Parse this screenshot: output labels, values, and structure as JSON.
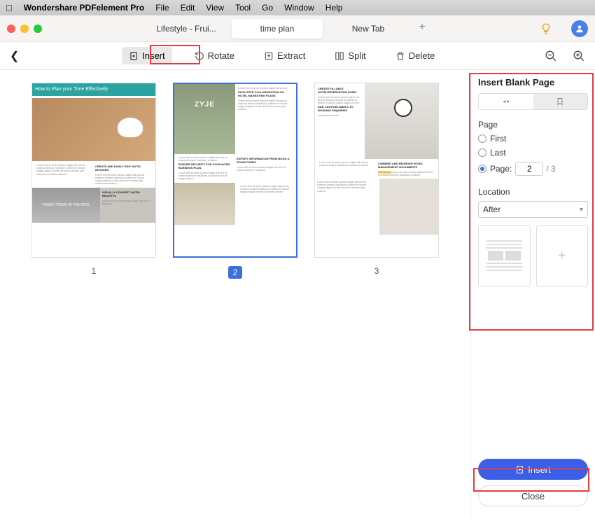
{
  "menubar": {
    "app": "Wondershare PDFelement Pro",
    "items": [
      "File",
      "Edit",
      "View",
      "Tool",
      "Go",
      "Window",
      "Help"
    ]
  },
  "tabs": {
    "t1": "Lifestyle - Frui...",
    "t2": "time plan",
    "t3": "New Tab"
  },
  "toolbar": {
    "insert": "Insert",
    "rotate": "Rotate",
    "extract": "Extract",
    "split": "Split",
    "delete": "Delete"
  },
  "pages": {
    "p1": "1",
    "p2": "2",
    "p3": "3",
    "title1": "How to Plan your Time Effectively",
    "sec1a": "CREATE AND EASILY EDIT HOTEL INVOICES",
    "sec1b": "VISUALLY CONVERT HOTEL RECEIPTS",
    "punch": "PUNCH TODAY IN THE FACE",
    "sec2a": "FACILITATE COLLABORATION ON HOTEL MARKETING PLANS",
    "sec2b": "ENSURE SECURITY FOR YOUR HOTEL BUSINESS PLAN",
    "sec2c": "EXPORT INFORMATION FROM BOOK A ROOM FORMS",
    "sec3a": "CREATE FILLABLE HOTELRESERVATION FORM",
    "sec3b": "ADD CUSTOM LABELS TO BOOKING ENQUIRIES",
    "sec3c": "COMBINE AND REORDER HOTEL MANAGEMENT DOCUMENTS"
  },
  "sidepanel": {
    "title": "Insert Blank Page",
    "page_label": "Page",
    "first": "First",
    "last": "Last",
    "pagecolon": "Page:",
    "page_value": "2",
    "total": "/  3",
    "location_label": "Location",
    "location_value": "After",
    "insert_btn": "Insert",
    "close_btn": "Close"
  }
}
